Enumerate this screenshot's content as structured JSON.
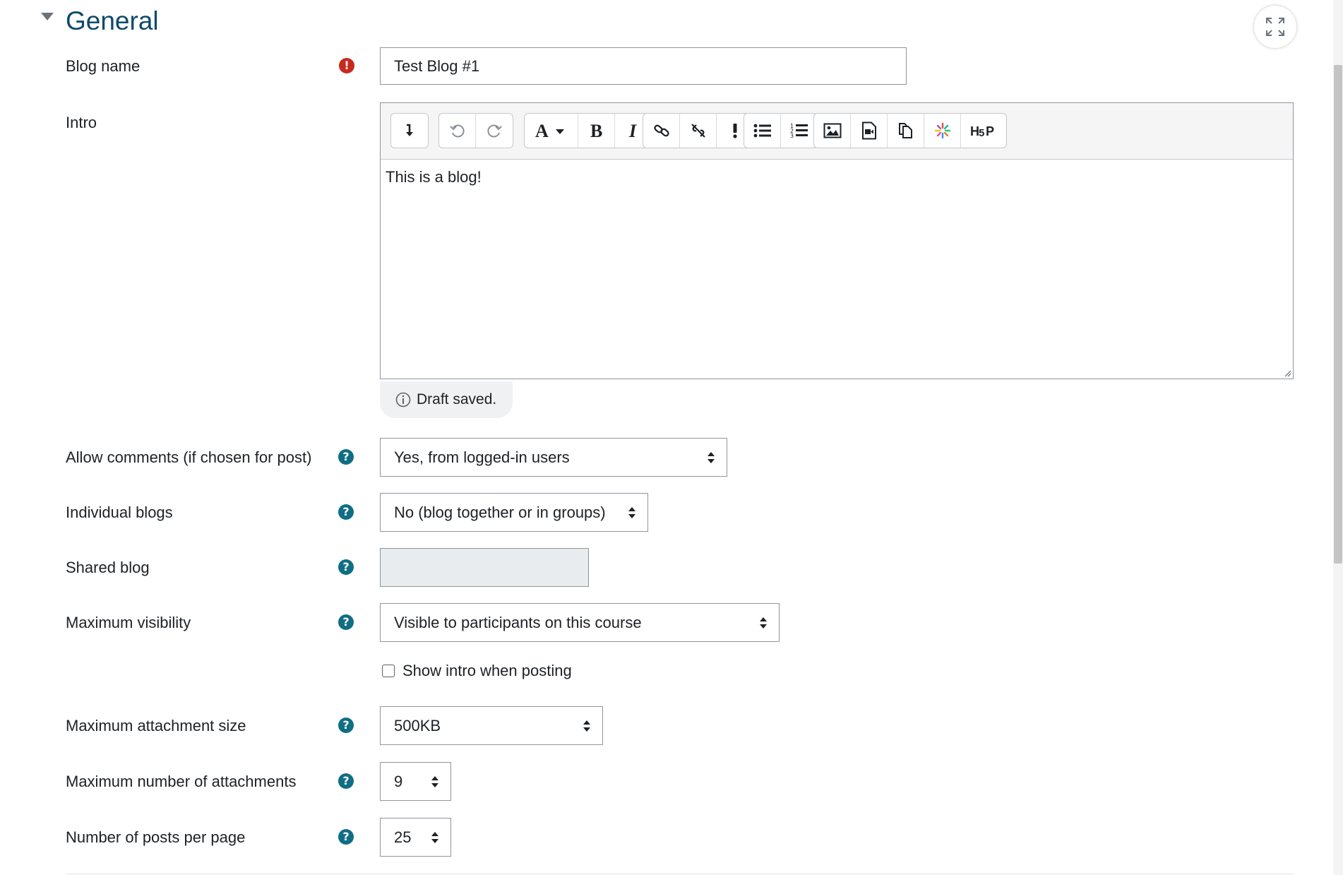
{
  "section": {
    "title": "General"
  },
  "form": {
    "blog_name": {
      "label": "Blog name",
      "value": "Test Blog #1"
    },
    "intro": {
      "label": "Intro",
      "content": "This is a blog!",
      "draft_status": "Draft saved."
    },
    "allow_comments": {
      "label": "Allow comments (if chosen for post)",
      "value": "Yes, from logged-in users"
    },
    "individual_blogs": {
      "label": "Individual blogs",
      "value": "No (blog together or in groups)"
    },
    "shared_blog": {
      "label": "Shared blog",
      "value": ""
    },
    "max_visibility": {
      "label": "Maximum visibility",
      "value": "Visible to participants on this course"
    },
    "show_intro": {
      "label": "Show intro when posting",
      "checked": false
    },
    "max_attachment_size": {
      "label": "Maximum attachment size",
      "value": "500KB"
    },
    "max_attachments": {
      "label": "Maximum number of attachments",
      "value": "9"
    },
    "posts_per_page": {
      "label": "Number of posts per page",
      "value": "25"
    }
  },
  "icons": {
    "required": "exclamation-circle-icon",
    "help": "question-circle-icon",
    "info": "info-circle-icon"
  },
  "colors": {
    "title": "#0f4a6b",
    "help_icon": "#0f6e84",
    "required_icon": "#c7291d"
  }
}
